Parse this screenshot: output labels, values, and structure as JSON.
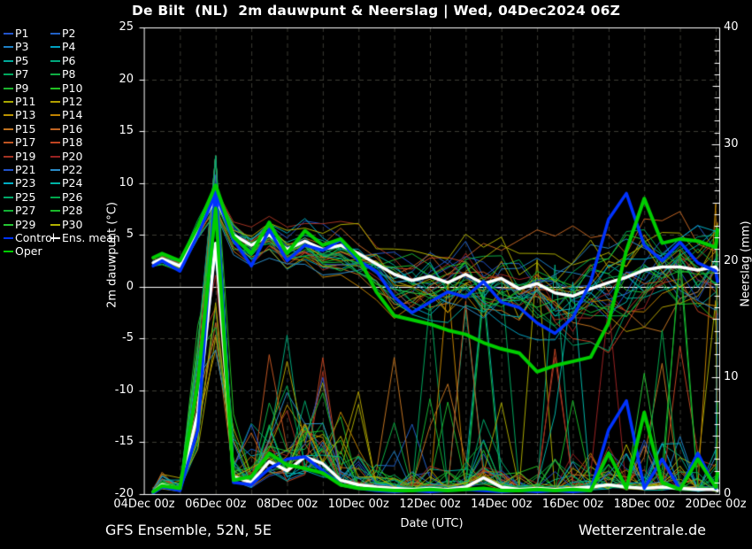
{
  "title": "De Bilt  (NL)  2m dauwpunt & Neerslag | Wed, 04Dec2024 06Z",
  "footer": {
    "left": "GFS Ensemble, 52N, 5E",
    "right": "Wetterzentrale.de"
  },
  "colors": {
    "background": "#000000",
    "axis": "#ffffff",
    "grid": "#3c3c34",
    "zero_line": "#ffffff",
    "ens_mean": "#ffffff",
    "control": "#0033ff",
    "oper": "#00cc00"
  },
  "legend": {
    "items": [
      {
        "label": "P1",
        "color": "#2255cc"
      },
      {
        "label": "P2",
        "color": "#2161c6"
      },
      {
        "label": "P3",
        "color": "#1d7fc4"
      },
      {
        "label": "P4",
        "color": "#00a0c0"
      },
      {
        "label": "P5",
        "color": "#00a89a"
      },
      {
        "label": "P6",
        "color": "#00a87c"
      },
      {
        "label": "P7",
        "color": "#00a85e"
      },
      {
        "label": "P8",
        "color": "#0fae44"
      },
      {
        "label": "P9",
        "color": "#1db42e"
      },
      {
        "label": "P10",
        "color": "#22c122"
      },
      {
        "label": "P11",
        "color": "#a8a800"
      },
      {
        "label": "P12",
        "color": "#b2a000"
      },
      {
        "label": "P13",
        "color": "#ba9200"
      },
      {
        "label": "P14",
        "color": "#c08200"
      },
      {
        "label": "P15",
        "color": "#c07320"
      },
      {
        "label": "P16",
        "color": "#c06422"
      },
      {
        "label": "P17",
        "color": "#c05522"
      },
      {
        "label": "P18",
        "color": "#c04422"
      },
      {
        "label": "P19",
        "color": "#a33322"
      },
      {
        "label": "P20",
        "color": "#992222"
      },
      {
        "label": "P21",
        "color": "#2152c8"
      },
      {
        "label": "P22",
        "color": "#2b8cc8"
      },
      {
        "label": "P23",
        "color": "#00aec4"
      },
      {
        "label": "P24",
        "color": "#00b4a6"
      },
      {
        "label": "P25",
        "color": "#00a86a"
      },
      {
        "label": "P26",
        "color": "#00a84c"
      },
      {
        "label": "P27",
        "color": "#12b034"
      },
      {
        "label": "P28",
        "color": "#1aba2a"
      },
      {
        "label": "P29",
        "color": "#24c432"
      },
      {
        "label": "P30",
        "color": "#b2b200"
      },
      {
        "label": "Control",
        "color": "#0033ff"
      },
      {
        "label": "Ens. mean",
        "color": "#ffffff"
      },
      {
        "label": "Oper",
        "color": "#00cc00"
      }
    ]
  },
  "chart_data": {
    "type": "line",
    "title": "De Bilt  (NL)  2m dauwpunt & Neerslag | Wed, 04Dec2024 06Z",
    "x_axis": {
      "label": "Date (UTC)",
      "tick_labels": [
        "04Dec 00z",
        "06Dec 00z",
        "08Dec 00z",
        "10Dec 00z",
        "12Dec 00z",
        "14Dec 00z",
        "16Dec 00z",
        "18Dec 00z",
        "20Dec 00z"
      ],
      "tick_days": [
        0,
        2,
        4,
        6,
        8,
        10,
        12,
        14,
        16
      ],
      "range_days": [
        0,
        16.1
      ],
      "grid_step_days": 1
    },
    "y_left": {
      "label": "2m dauwpunt (°C)",
      "range": [
        -20,
        25
      ],
      "ticks": [
        25,
        20,
        15,
        10,
        5,
        0,
        -5,
        -10,
        -15,
        -20
      ],
      "grid_step": 5,
      "zero_line": true
    },
    "y_right": {
      "label": "Neerslag (mm)",
      "range": [
        0,
        40
      ],
      "ticks": [
        40,
        30,
        20,
        10,
        0
      ],
      "minor_tick_step": 1
    },
    "sample_days": [
      0.25,
      0.5,
      1,
      1.5,
      2,
      2.5,
      3,
      3.5,
      4,
      4.5,
      5,
      5.5,
      6,
      6.5,
      7,
      7.5,
      8,
      8.5,
      9,
      9.5,
      10,
      10.5,
      11,
      11.5,
      12,
      12.5,
      13,
      13.5,
      14,
      14.5,
      15,
      15.5,
      16,
      16.05
    ],
    "series": [
      {
        "name": "Ens. mean",
        "variable": "dewpoint",
        "axis": "left",
        "color": "#ffffff",
        "width": 3.5,
        "values": [
          2.3,
          2.7,
          2.0,
          5.5,
          8.5,
          5.0,
          4.0,
          5.0,
          3.6,
          4.4,
          3.6,
          4.0,
          3.2,
          2.2,
          1.2,
          0.6,
          1.0,
          0.4,
          1.2,
          0.3,
          0.8,
          -0.2,
          0.3,
          -0.6,
          -0.9,
          -0.2,
          0.4,
          0.9,
          1.6,
          1.9,
          1.9,
          1.6,
          1.9,
          1.6
        ]
      },
      {
        "name": "Control",
        "variable": "dewpoint",
        "axis": "left",
        "color": "#0033ff",
        "width": 3.5,
        "values": [
          2.0,
          2.5,
          1.5,
          5.0,
          9.0,
          4.5,
          2.0,
          5.5,
          2.5,
          4.0,
          3.5,
          4.5,
          2.5,
          1.5,
          -1.0,
          -2.5,
          -1.5,
          -0.5,
          -1.0,
          0.5,
          -1.5,
          -2.0,
          -3.5,
          -4.5,
          -3.0,
          0.5,
          6.5,
          9.0,
          4.0,
          2.5,
          4.3,
          2.3,
          1.5,
          0.5
        ]
      },
      {
        "name": "Oper",
        "variable": "dewpoint",
        "axis": "left",
        "color": "#00cc00",
        "width": 4,
        "values": [
          2.8,
          3.2,
          2.5,
          5.8,
          9.8,
          4.8,
          3.2,
          6.2,
          3.2,
          5.4,
          4.0,
          4.6,
          2.8,
          -0.5,
          -2.8,
          -3.2,
          -3.6,
          -4.2,
          -4.6,
          -5.4,
          -6.0,
          -6.4,
          -8.2,
          -7.6,
          -7.2,
          -6.8,
          -3.5,
          3.5,
          8.5,
          4.2,
          4.6,
          4.4,
          3.8,
          5.5
        ]
      },
      {
        "name": "Ens. mean",
        "variable": "precip",
        "axis": "right",
        "color": "#ffffff",
        "width": 3.5,
        "values": [
          0.2,
          0.8,
          0.4,
          7.0,
          21.5,
          1.5,
          1.0,
          2.8,
          2.0,
          3.2,
          2.6,
          1.2,
          0.8,
          0.6,
          0.5,
          0.4,
          0.5,
          0.4,
          0.6,
          1.4,
          0.6,
          0.4,
          0.5,
          0.4,
          0.5,
          0.6,
          0.8,
          0.6,
          0.5,
          0.6,
          0.5,
          0.4,
          0.4,
          0.3
        ]
      },
      {
        "name": "Control",
        "variable": "precip",
        "axis": "right",
        "color": "#0033ff",
        "width": 3.5,
        "values": [
          0.1,
          0.6,
          0.3,
          5.5,
          26.5,
          1.0,
          0.8,
          2.2,
          3.0,
          3.2,
          2.0,
          0.8,
          0.5,
          0.3,
          0.2,
          0.3,
          0.2,
          0.3,
          0.4,
          0.3,
          0.2,
          0.3,
          0.2,
          0.3,
          0.2,
          0.3,
          5.5,
          8.0,
          0.5,
          3.0,
          0.4,
          3.5,
          0.5,
          1.5
        ]
      },
      {
        "name": "Oper",
        "variable": "precip",
        "axis": "right",
        "color": "#00cc00",
        "width": 4,
        "values": [
          0.2,
          0.7,
          0.5,
          9.5,
          24.5,
          1.2,
          1.5,
          3.5,
          2.5,
          2.2,
          1.8,
          0.8,
          0.5,
          0.4,
          0.3,
          0.3,
          0.4,
          0.3,
          0.4,
          0.5,
          0.3,
          0.3,
          0.4,
          0.3,
          0.4,
          0.3,
          3.5,
          0.5,
          7.0,
          1.0,
          0.4,
          3.0,
          0.6,
          1.8
        ]
      }
    ],
    "ensemble_members": {
      "count": 30,
      "seed": 20241204,
      "line_width": 1,
      "colors": [
        "#2255cc",
        "#2161c6",
        "#1d7fc4",
        "#00a0c0",
        "#00a89a",
        "#00a87c",
        "#00a85e",
        "#0fae44",
        "#1db42e",
        "#22c122",
        "#a8a800",
        "#b2a000",
        "#ba9200",
        "#c08200",
        "#c07320",
        "#c06422",
        "#c05522",
        "#c04422",
        "#a33322",
        "#992222",
        "#2152c8",
        "#2b8cc8",
        "#00aec4",
        "#00b4a6",
        "#00a86a",
        "#00a84c",
        "#12b034",
        "#1aba2a",
        "#24c432",
        "#b2b200"
      ],
      "dew_spread_per_sample": [
        0.4,
        0.5,
        0.7,
        0.9,
        1.1,
        1.3,
        1.4,
        1.5,
        1.6,
        1.8,
        1.9,
        2.1,
        2.3,
        2.5,
        2.7,
        2.9,
        3.1,
        3.3,
        3.4,
        3.6,
        3.7,
        3.9,
        4.0,
        4.1,
        4.2,
        4.3,
        4.4,
        4.4,
        4.5,
        4.5,
        4.6,
        4.6,
        4.7,
        4.7
      ],
      "precip_envelope_per_sample": [
        0.3,
        0.6,
        0.5,
        5,
        7,
        3,
        4,
        7,
        9,
        9,
        7,
        4,
        2,
        1.5,
        1.2,
        1.2,
        1.2,
        1.2,
        1.5,
        2,
        1.5,
        1.2,
        1.5,
        2,
        2,
        2.5,
        3,
        3,
        3,
        3,
        3,
        3,
        2.5,
        2
      ]
    }
  }
}
